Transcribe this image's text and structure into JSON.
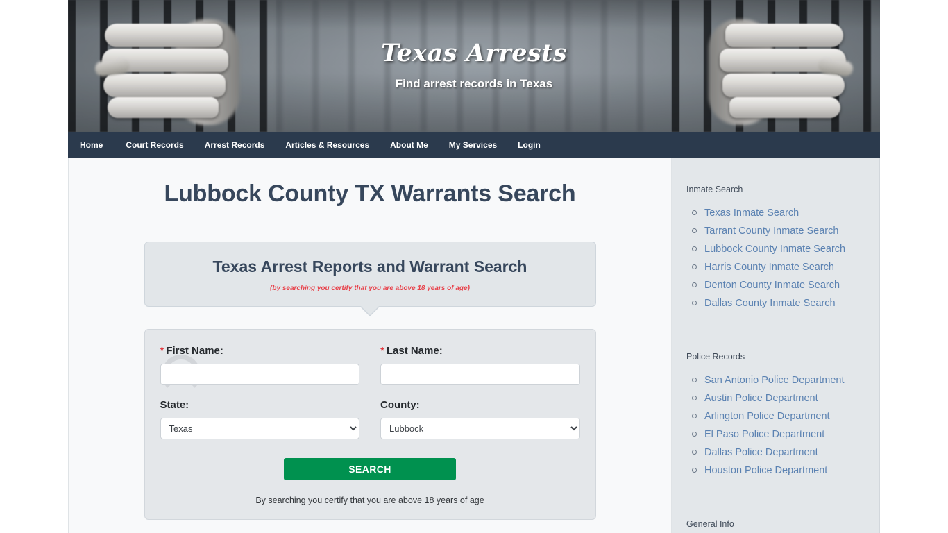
{
  "header": {
    "title": "Texas Arrests",
    "tagline": "Find arrest records in Texas"
  },
  "nav": {
    "items": [
      {
        "label": "Home"
      },
      {
        "label": "Court Records"
      },
      {
        "label": "Arrest Records"
      },
      {
        "label": "Articles & Resources"
      },
      {
        "label": "About Me"
      },
      {
        "label": "My Services"
      },
      {
        "label": "Login"
      }
    ]
  },
  "main": {
    "page_title": "Lubbock County TX Warrants Search",
    "callout": {
      "heading": "Texas Arrest Reports and Warrant Search",
      "disclaimer": "(by searching you certify that you are above 18 years of age)"
    },
    "form": {
      "first_name_label": "First Name:",
      "last_name_label": "Last Name:",
      "required_marker": "*",
      "first_name_value": "",
      "last_name_value": "",
      "first_name_placeholder": "",
      "last_name_placeholder": "",
      "state_label": "State:",
      "county_label": "County:",
      "state_value": "Texas",
      "county_value": "Lubbock",
      "state_options": [
        "Texas"
      ],
      "county_options": [
        "Lubbock"
      ],
      "search_button": "SEARCH",
      "footnote": "By searching you certify that you are above 18 years of age"
    }
  },
  "sidebar": {
    "widgets": [
      {
        "title": "Inmate Search",
        "links": [
          {
            "label": "Texas Inmate Search"
          },
          {
            "label": "Tarrant County Inmate Search"
          },
          {
            "label": "Lubbock County Inmate Search"
          },
          {
            "label": "Harris County Inmate Search"
          },
          {
            "label": "Denton County Inmate Search"
          },
          {
            "label": "Dallas County Inmate Search"
          }
        ]
      },
      {
        "title": "Police Records",
        "links": [
          {
            "label": "San Antonio Police Department"
          },
          {
            "label": "Austin Police Department"
          },
          {
            "label": "Arlington Police Department"
          },
          {
            "label": "El Paso Police Department"
          },
          {
            "label": "Dallas Police Department"
          },
          {
            "label": "Houston Police Department"
          }
        ]
      },
      {
        "title": "General Info",
        "links": []
      }
    ]
  },
  "colors": {
    "nav_bg": "#2b3a4d",
    "title_text": "#37475c",
    "link_blue": "#5b82b2",
    "search_green": "#00914f",
    "disclaimer_red": "#e8414a",
    "panel_bg": "#e4e7ea",
    "sidebar_bg": "#e3e7ea"
  }
}
